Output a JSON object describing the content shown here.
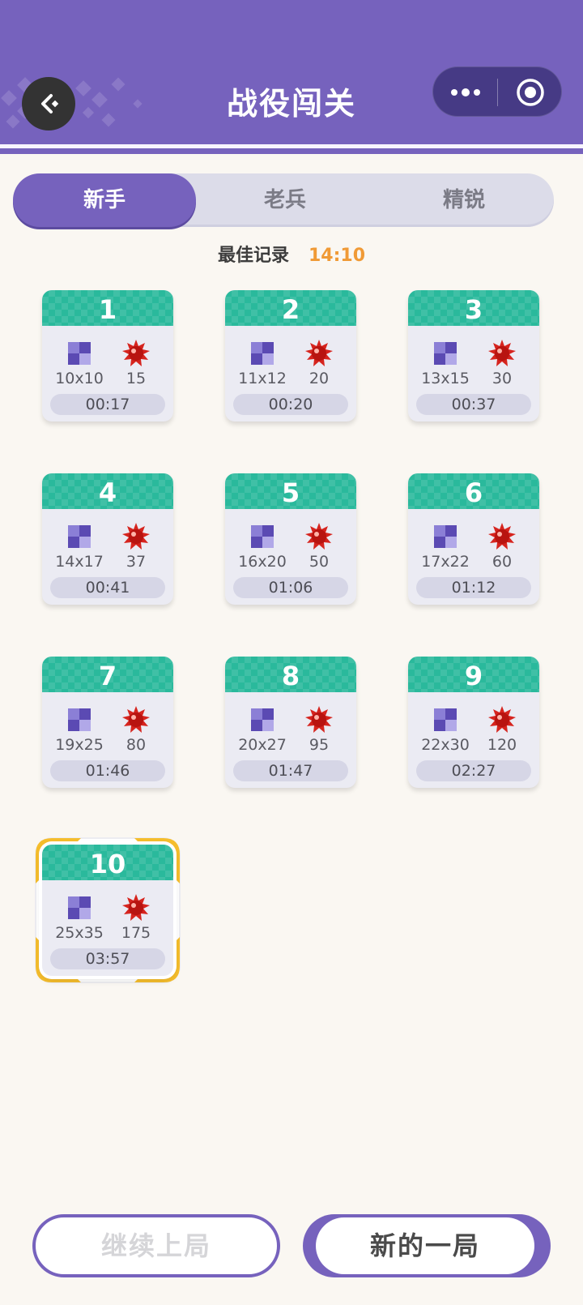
{
  "header": {
    "title": "战役闯关",
    "back_icon": "back-icon",
    "more_icon": "more-dots-icon",
    "close_icon": "target-close-icon",
    "color": "#7662bd"
  },
  "tabs": [
    {
      "label": "新手",
      "active": true
    },
    {
      "label": "老兵",
      "active": false
    },
    {
      "label": "精锐",
      "active": false
    }
  ],
  "best_record": {
    "label": "最佳记录",
    "value": "14:10"
  },
  "levels": [
    {
      "number": "1",
      "size": "10x10",
      "mines": "15",
      "time": "00:17"
    },
    {
      "number": "2",
      "size": "11x12",
      "mines": "20",
      "time": "00:20"
    },
    {
      "number": "3",
      "size": "13x15",
      "mines": "30",
      "time": "00:37"
    },
    {
      "number": "4",
      "size": "14x17",
      "mines": "37",
      "time": "00:41"
    },
    {
      "number": "5",
      "size": "16x20",
      "mines": "50",
      "time": "01:06"
    },
    {
      "number": "6",
      "size": "17x22",
      "mines": "60",
      "time": "01:12"
    },
    {
      "number": "7",
      "size": "19x25",
      "mines": "80",
      "time": "01:46"
    },
    {
      "number": "8",
      "size": "20x27",
      "mines": "95",
      "time": "01:47"
    },
    {
      "number": "9",
      "size": "22x30",
      "mines": "120",
      "time": "02:27"
    },
    {
      "number": "10",
      "size": "25x35",
      "mines": "175",
      "time": "03:57",
      "selected": true
    }
  ],
  "icons": {
    "grid": "grid-size-icon",
    "mine": "mine-icon"
  },
  "colors": {
    "accent": "#7662bd",
    "card_header": "#2ab99c",
    "record": "#f09a36",
    "selection": "#f5bd2c"
  },
  "buttons": {
    "continue_label": "继续上局",
    "continue_disabled": true,
    "new_game_label": "新的一局"
  }
}
